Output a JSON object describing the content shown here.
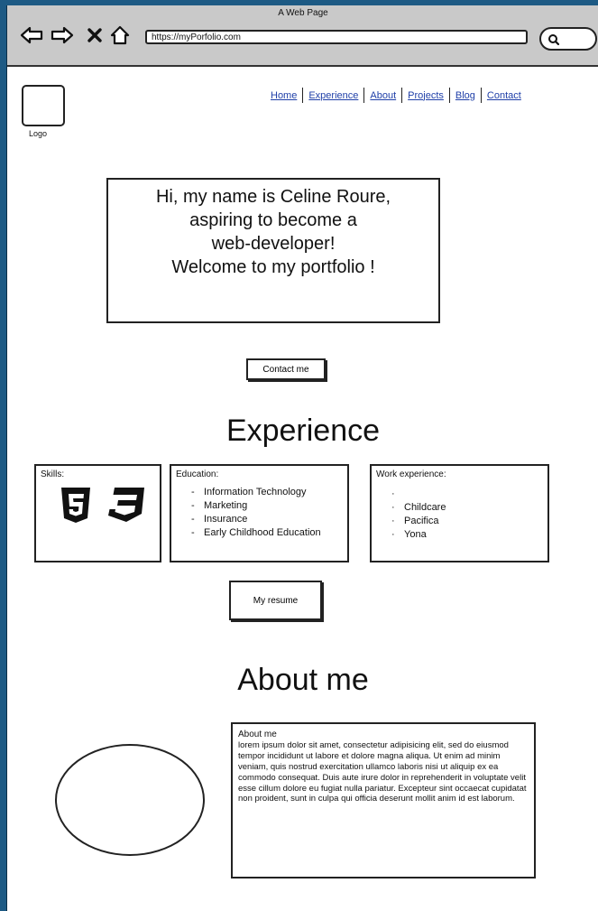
{
  "browser": {
    "title": "A Web Page",
    "url": "https://myPorfolio.com"
  },
  "logo": {
    "label": "Logo"
  },
  "nav": {
    "items": [
      "Home",
      "Experience",
      "About",
      "Projects",
      "Blog",
      "Contact"
    ]
  },
  "hero": {
    "text": "Hi, my name is Celine Roure,\naspiring to become a\nweb-developer!\nWelcome to my portfolio !"
  },
  "contact_button": "Contact me",
  "experience": {
    "title": "Experience",
    "skills_label": "Skills:",
    "skill_icons": [
      "html5-icon",
      "css3-icon"
    ],
    "education_label": "Education:",
    "education_items": [
      "Information Technology",
      "Marketing",
      "Insurance",
      "Early Childhood Education"
    ],
    "work_label": "Work experience:",
    "work_items": [
      "",
      "Childcare",
      "Pacifica",
      "Yona"
    ]
  },
  "resume_button": "My resume",
  "about": {
    "title": "About me",
    "heading": "About me",
    "body": "lorem ipsum dolor sit amet, consectetur adipisicing elit, sed do eiusmod tempor incididunt ut labore et dolore magna aliqua. Ut enim ad minim veniam, quis nostrud exercitation ullamco laboris nisi ut aliquip ex ea commodo consequat. Duis aute irure dolor in reprehenderit in voluptate velit esse cillum dolore eu fugiat nulla pariatur. Excepteur sint occaecat cupidatat non proident, sunt in culpa qui officia deserunt mollit anim id est laborum."
  },
  "colors": {
    "desktop": "#1d5a84",
    "chrome": "#c9c9c9",
    "link": "#1f3fa8"
  }
}
